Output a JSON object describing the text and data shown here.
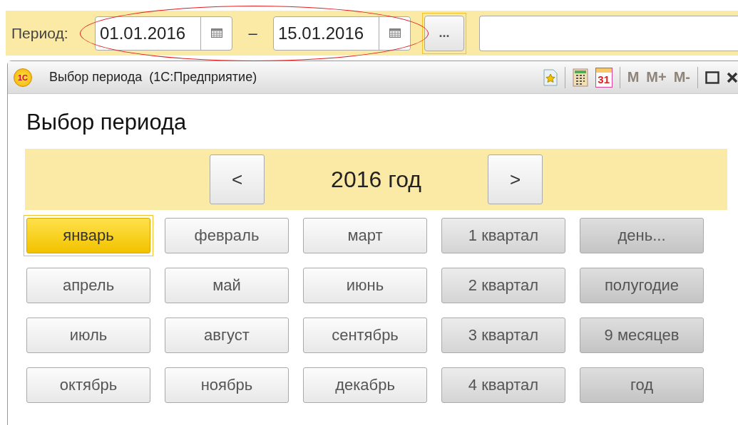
{
  "period_bar": {
    "label": "Период:",
    "start_date": "01.01.2016",
    "separator": "–",
    "end_date": "15.01.2016",
    "more_button": "...",
    "highlighted": true
  },
  "dialog": {
    "logo": "1С",
    "title": "Выбор периода  (1С:Предприятие)",
    "toolbar": [
      {
        "kind": "favorite"
      },
      {
        "kind": "calculator"
      },
      {
        "kind": "calendar",
        "text": "31"
      },
      {
        "kind": "memory",
        "text": "M"
      },
      {
        "kind": "memory",
        "text": "M+"
      },
      {
        "kind": "memory",
        "text": "M-"
      },
      {
        "kind": "maximize"
      },
      {
        "kind": "close"
      }
    ],
    "heading": "Выбор периода",
    "prev": "<",
    "year": "2016 год",
    "next": ">",
    "periods": [
      {
        "label": "январь",
        "kind": "month",
        "selected": true
      },
      {
        "label": "февраль",
        "kind": "month",
        "selected": false
      },
      {
        "label": "март",
        "kind": "month",
        "selected": false
      },
      {
        "label": "1 квартал",
        "kind": "quarter",
        "selected": false
      },
      {
        "label": "день...",
        "kind": "other",
        "selected": false
      },
      {
        "label": "апрель",
        "kind": "month",
        "selected": false
      },
      {
        "label": "май",
        "kind": "month",
        "selected": false
      },
      {
        "label": "июнь",
        "kind": "month",
        "selected": false
      },
      {
        "label": "2 квартал",
        "kind": "quarter",
        "selected": false
      },
      {
        "label": "полугодие",
        "kind": "other",
        "selected": false
      },
      {
        "label": "июль",
        "kind": "month",
        "selected": false
      },
      {
        "label": "август",
        "kind": "month",
        "selected": false
      },
      {
        "label": "сентябрь",
        "kind": "month",
        "selected": false
      },
      {
        "label": "3 квартал",
        "kind": "quarter",
        "selected": false
      },
      {
        "label": "9 месяцев",
        "kind": "other",
        "selected": false
      },
      {
        "label": "октябрь",
        "kind": "month",
        "selected": false
      },
      {
        "label": "ноябрь",
        "kind": "month",
        "selected": false
      },
      {
        "label": "декабрь",
        "kind": "month",
        "selected": false
      },
      {
        "label": "4 квартал",
        "kind": "quarter",
        "selected": false
      },
      {
        "label": "год",
        "kind": "other",
        "selected": false
      }
    ]
  }
}
